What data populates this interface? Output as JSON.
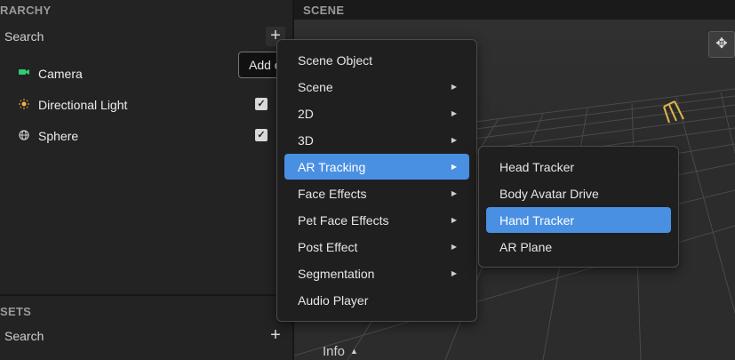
{
  "hierarchy": {
    "header": "RARCHY",
    "search_placeholder": "Search",
    "add_symbol": "+",
    "items": [
      {
        "name": "Camera",
        "icon": "camera-icon",
        "icon_color": "#2ecc71",
        "checked": false
      },
      {
        "name": "Directional Light",
        "icon": "sun-icon",
        "icon_color": "#f5b041",
        "checked": true
      },
      {
        "name": "Sphere",
        "icon": "sphere-icon",
        "icon_color": "#cfcfcf",
        "checked": true
      }
    ]
  },
  "assets": {
    "header": "SETS",
    "search_placeholder": "Search",
    "add_symbol": "+"
  },
  "tooltip": "Add o",
  "scene": {
    "header": "SCENE",
    "info_label": "Info"
  },
  "add_menu": {
    "items": [
      {
        "label": "Scene Object",
        "submenu": false
      },
      {
        "label": "Scene",
        "submenu": true
      },
      {
        "label": "2D",
        "submenu": true
      },
      {
        "label": "3D",
        "submenu": true
      },
      {
        "label": "AR Tracking",
        "submenu": true,
        "selected": true
      },
      {
        "label": "Face Effects",
        "submenu": true
      },
      {
        "label": "Pet Face Effects",
        "submenu": true
      },
      {
        "label": "Post Effect",
        "submenu": true
      },
      {
        "label": "Segmentation",
        "submenu": true
      },
      {
        "label": "Audio Player",
        "submenu": false
      }
    ]
  },
  "ar_tracking_submenu": {
    "items": [
      {
        "label": "Head Tracker"
      },
      {
        "label": "Body Avatar Drive"
      },
      {
        "label": "Hand Tracker",
        "selected": true
      },
      {
        "label": "AR Plane"
      }
    ]
  },
  "colors": {
    "accent": "#4a90e2"
  }
}
